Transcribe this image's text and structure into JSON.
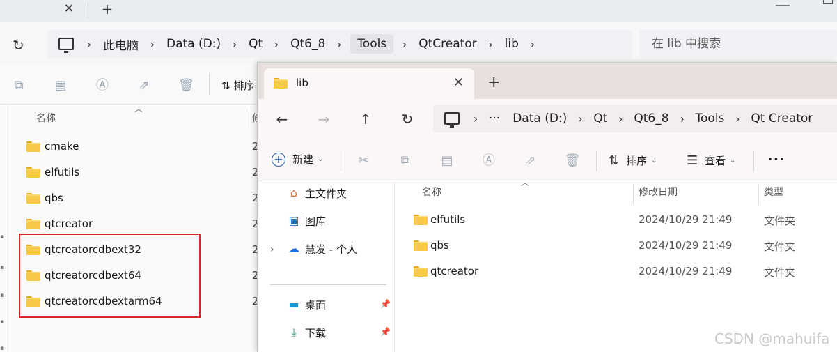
{
  "back_window": {
    "address_bar": {
      "segments": [
        "此电脑",
        "Data (D:)",
        "Qt",
        "Qt6_8",
        "Tools",
        "QtCreator",
        "lib"
      ]
    },
    "search": {
      "placeholder": "在 lib 中搜索"
    },
    "toolbar": {
      "sort_label": "排序"
    },
    "columns": {
      "name": "名称",
      "date": "修"
    },
    "folders": [
      {
        "name": "cmake",
        "date": "2"
      },
      {
        "name": "elfutils",
        "date": "2"
      },
      {
        "name": "qbs",
        "date": "2"
      },
      {
        "name": "qtcreator",
        "date": "2"
      },
      {
        "name": "qtcreatorcdbext32",
        "date": "2"
      },
      {
        "name": "qtcreatorcdbext64",
        "date": "2"
      },
      {
        "name": "qtcreatorcdbextarm64",
        "date": "2"
      }
    ]
  },
  "front_window": {
    "tab": {
      "title": "lib"
    },
    "address_bar": {
      "more": "···",
      "segments": [
        "Data (D:)",
        "Qt",
        "Qt6_8",
        "Tools",
        "Qt Creator"
      ]
    },
    "toolbar": {
      "new_label": "新建",
      "sort_label": "排序",
      "view_label": "查看",
      "more_label": "···"
    },
    "sidebar": {
      "items": [
        {
          "label": "主文件夹",
          "icon": "home-icon"
        },
        {
          "label": "图库",
          "icon": "gallery-icon"
        },
        {
          "label": "慧发 - 个人",
          "icon": "onedrive-cloud-icon"
        },
        {
          "label": "桌面",
          "icon": "desktop-icon"
        },
        {
          "label": "下载",
          "icon": "download-icon"
        }
      ]
    },
    "columns": {
      "name": "名称",
      "date": "修改日期",
      "type": "类型"
    },
    "files": [
      {
        "name": "elfutils",
        "date": "2024/10/29 21:49",
        "type": "文件夹"
      },
      {
        "name": "qbs",
        "date": "2024/10/29 21:49",
        "type": "文件夹"
      },
      {
        "name": "qtcreator",
        "date": "2024/10/29 21:49",
        "type": "文件夹"
      }
    ]
  },
  "watermark": "CSDN @mahuifa",
  "colors": {
    "highlight_box": "#d8262d",
    "folder": "#f7c948",
    "accent": "#1f5fb0"
  }
}
